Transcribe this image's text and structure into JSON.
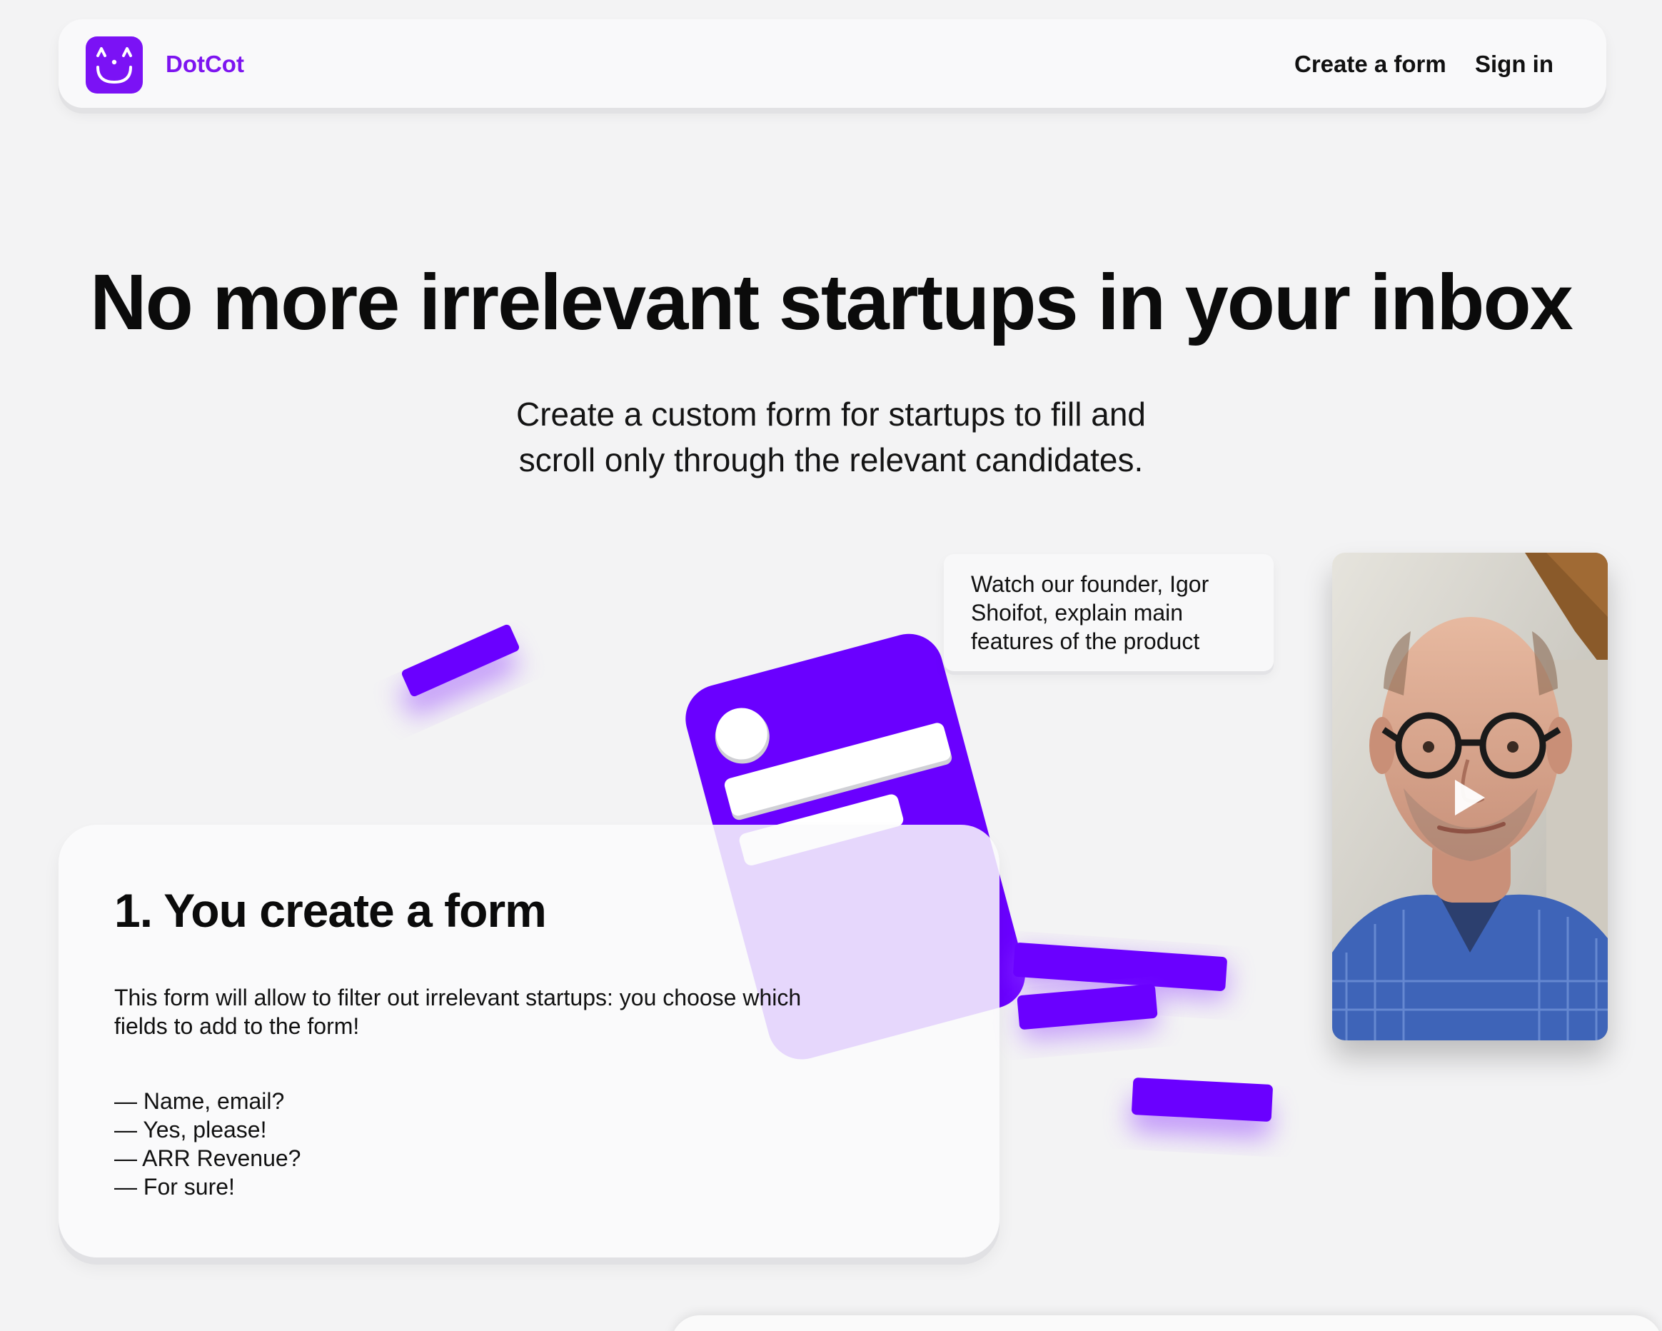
{
  "header": {
    "brand": "DotCot",
    "nav": {
      "create_form": "Create a form",
      "sign_in": "Sign in"
    }
  },
  "hero": {
    "title": "No more irrelevant startups in your inbox",
    "subtitle_line1": "Create a custom form for startups to fill and",
    "subtitle_line2": "scroll only through the relevant candidates."
  },
  "founder_callout": {
    "line1": "Watch our founder, Igor",
    "line2": "Shoifot, explain main",
    "line3": "features of the product"
  },
  "step": {
    "title": "1. You create a form",
    "desc_line1": "This form will allow to filter out irrelevant startups: you choose which",
    "desc_line2": "fields to add to the form!",
    "qa": [
      "— Name, email?",
      "— Yes, please!",
      "— ARR Revenue?",
      "— For sure!"
    ]
  },
  "colors": {
    "accent": "#7b12f5",
    "illustration_purple": "#6a00ff",
    "page_bg": "#f3f3f4"
  },
  "icons": {
    "logo": "smiling-cat-face-icon",
    "video": "play-icon"
  }
}
